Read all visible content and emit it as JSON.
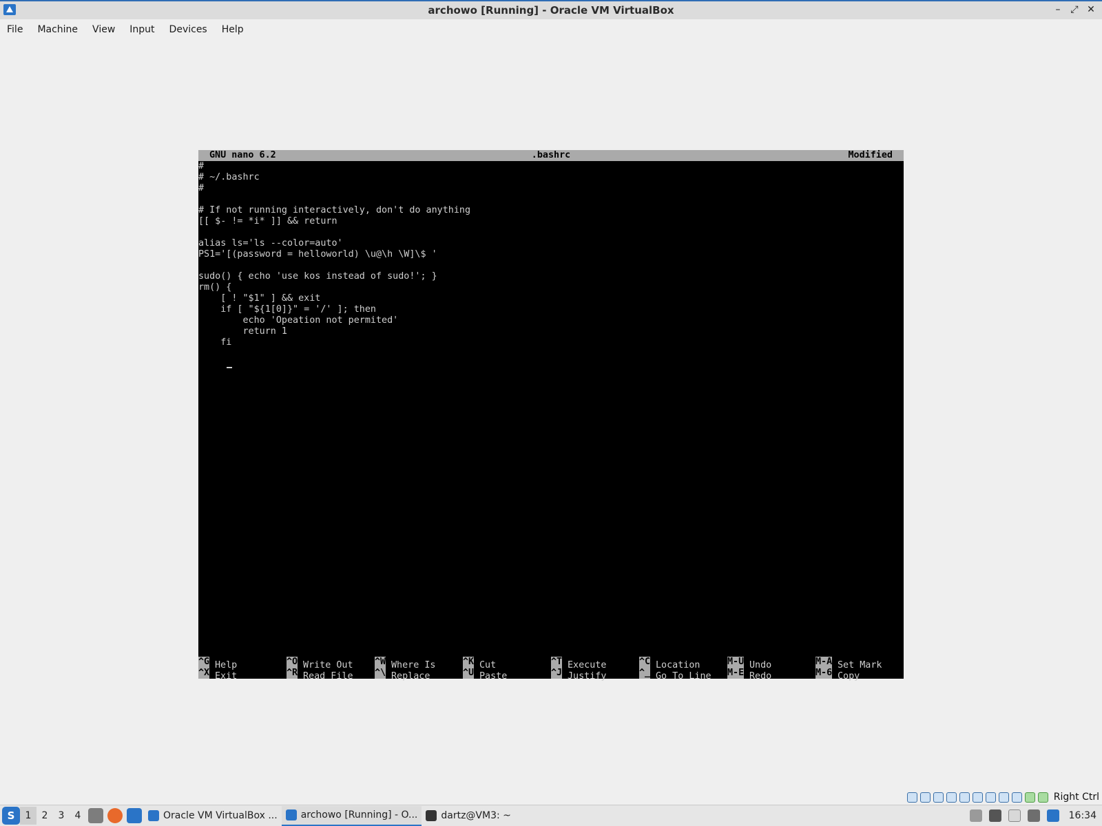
{
  "window": {
    "title": "archowo [Running] - Oracle VM VirtualBox",
    "buttons": [
      "–",
      "⤢",
      "✕"
    ]
  },
  "menu": [
    "File",
    "Machine",
    "View",
    "Input",
    "Devices",
    "Help"
  ],
  "nano": {
    "version": "GNU nano 6.2",
    "filename": ".bashrc",
    "status": "Modified",
    "lines": [
      "#",
      "# ~/.bashrc",
      "#",
      "",
      "# If not running interactively, don't do anything",
      "[[ $- != *i* ]] && return",
      "",
      "alias ls='ls --color=auto'",
      "PS1='[(password = helloworld) \\u@\\h \\W]\\$ '",
      "",
      "sudo() { echo 'use kos instead of sudo!'; }",
      "rm() {",
      "    [ ! \"$1\" ] && exit",
      "    if [ \"${1[0]}\" = '/' ]; then",
      "        echo 'Opeation not permited'",
      "        return 1",
      "    fi"
    ],
    "shortcuts": [
      {
        "key": "^G",
        "label": "Help"
      },
      {
        "key": "^X",
        "label": "Exit"
      },
      {
        "key": "^O",
        "label": "Write Out"
      },
      {
        "key": "^R",
        "label": "Read File"
      },
      {
        "key": "^W",
        "label": "Where Is"
      },
      {
        "key": "^\\",
        "label": "Replace"
      },
      {
        "key": "^K",
        "label": "Cut"
      },
      {
        "key": "^U",
        "label": "Paste"
      },
      {
        "key": "^T",
        "label": "Execute"
      },
      {
        "key": "^J",
        "label": "Justify"
      },
      {
        "key": "^C",
        "label": "Location"
      },
      {
        "key": "^_",
        "label": "Go To Line"
      },
      {
        "key": "M-U",
        "label": "Undo"
      },
      {
        "key": "M-E",
        "label": "Redo"
      },
      {
        "key": "M-A",
        "label": "Set Mark"
      },
      {
        "key": "M-6",
        "label": "Copy"
      }
    ]
  },
  "vbox_status": {
    "host_key": "Right Ctrl"
  },
  "taskbar": {
    "workspaces": [
      "1",
      "2",
      "3",
      "4"
    ],
    "tasks": [
      {
        "label": "Oracle VM VirtualBox ..."
      },
      {
        "label": "archowo [Running] - O..."
      },
      {
        "label": "dartz@VM3: ~"
      }
    ],
    "clock": "16:34"
  }
}
